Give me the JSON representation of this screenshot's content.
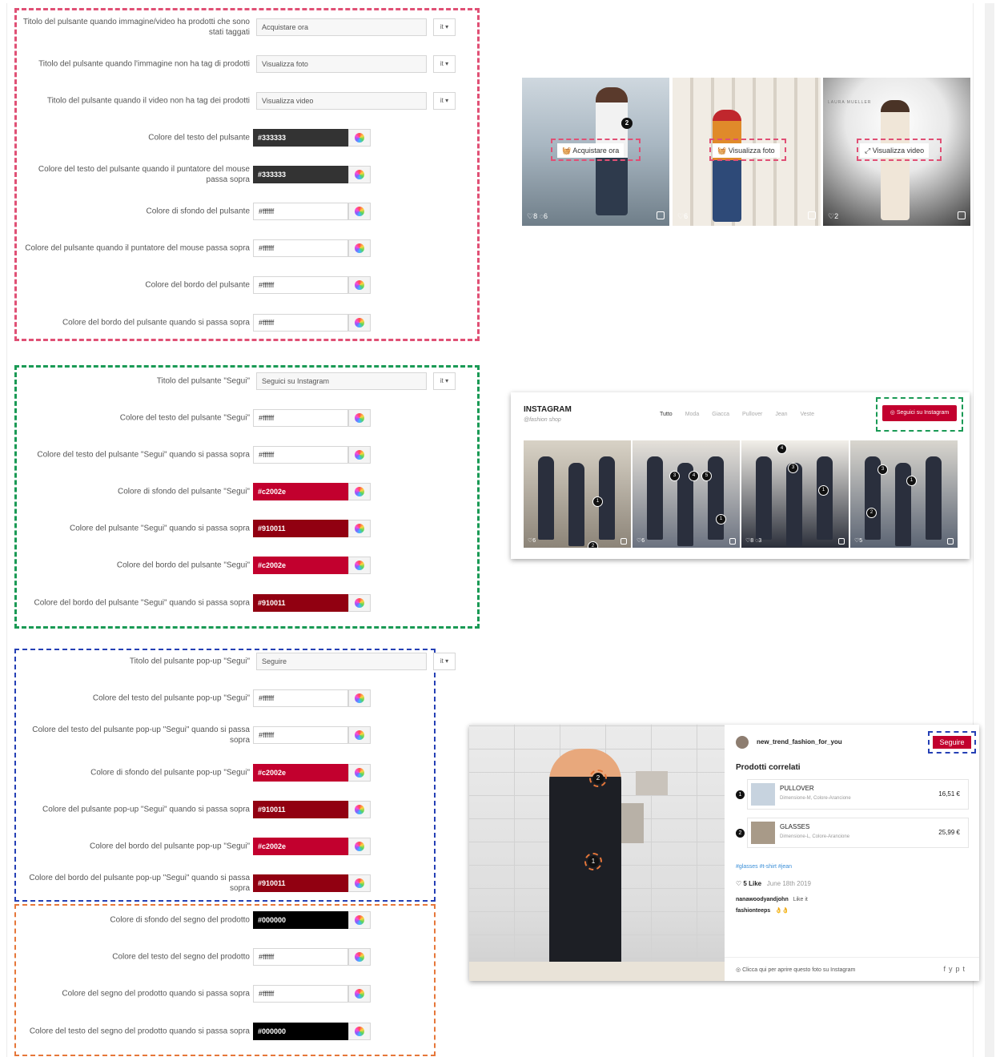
{
  "sections": {
    "shop": {
      "rows": [
        {
          "label": "Titolo del pulsante quando immagine/video ha prodotti che sono stati taggati",
          "type": "text",
          "value": "Acquistare ora",
          "lang": "it ▾"
        },
        {
          "label": "Titolo del pulsante quando l'immagine non ha tag di prodotti",
          "type": "text",
          "value": "Visualizza foto",
          "lang": "it ▾"
        },
        {
          "label": "Titolo del pulsante quando il video non ha tag dei prodotti",
          "type": "text",
          "value": "Visualizza video",
          "lang": "it ▾"
        },
        {
          "label": "Colore del testo del pulsante",
          "type": "color",
          "value": "#333333"
        },
        {
          "label": "Colore del testo del pulsante quando il puntatore del mouse passa sopra",
          "type": "color",
          "value": "#333333"
        },
        {
          "label": "Colore di sfondo del pulsante",
          "type": "color",
          "value": "#ffffff"
        },
        {
          "label": "Colore del pulsante quando il puntatore del mouse passa sopra",
          "type": "color",
          "value": "#ffffff"
        },
        {
          "label": "Colore del bordo del pulsante",
          "type": "color",
          "value": "#ffffff"
        },
        {
          "label": "Colore del bordo del pulsante quando si passa sopra",
          "type": "color",
          "value": "#ffffff"
        }
      ]
    },
    "follow": {
      "rows": [
        {
          "label": "Titolo del pulsante \"Segui\"",
          "type": "text",
          "value": "Seguici su Instagram",
          "lang": "it ▾"
        },
        {
          "label": "Colore del testo del pulsante \"Segui\"",
          "type": "color",
          "value": "#ffffff"
        },
        {
          "label": "Colore del testo del pulsante \"Segui\" quando si passa sopra",
          "type": "color",
          "value": "#ffffff"
        },
        {
          "label": "Colore di sfondo del pulsante \"Segui\"",
          "type": "color",
          "value": "#c2002e"
        },
        {
          "label": "Colore del pulsante \"Segui\" quando si passa sopra",
          "type": "color",
          "value": "#910011"
        },
        {
          "label": "Colore del bordo del pulsante \"Segui\"",
          "type": "color",
          "value": "#c2002e"
        },
        {
          "label": "Colore del bordo del pulsante \"Segui\" quando si passa sopra",
          "type": "color",
          "value": "#910011"
        }
      ]
    },
    "popup": {
      "rows": [
        {
          "label": "Titolo del pulsante pop-up \"Segui\"",
          "type": "text",
          "value": "Seguire",
          "lang": "it ▾"
        },
        {
          "label": "Colore del testo del pulsante pop-up \"Segui\"",
          "type": "color",
          "value": "#ffffff"
        },
        {
          "label": "Colore del testo del pulsante pop-up \"Segui\" quando si passa sopra",
          "type": "color",
          "value": "#ffffff"
        },
        {
          "label": "Colore di sfondo del pulsante pop-up \"Segui\"",
          "type": "color",
          "value": "#c2002e"
        },
        {
          "label": "Colore del pulsante pop-up \"Segui\" quando si passa sopra",
          "type": "color",
          "value": "#910011"
        },
        {
          "label": "Colore del bordo del pulsante pop-up \"Segui\"",
          "type": "color",
          "value": "#c2002e"
        },
        {
          "label": "Colore del bordo del pulsante pop-up \"Segui\" quando si passa sopra",
          "type": "color",
          "value": "#910011"
        }
      ]
    },
    "tag": {
      "rows": [
        {
          "label": "Colore di sfondo del segno del prodotto",
          "type": "color",
          "value": "#000000"
        },
        {
          "label": "Colore del testo del segno del prodotto",
          "type": "color",
          "value": "#ffffff"
        },
        {
          "label": "Colore del segno del prodotto quando si passa sopra",
          "type": "color",
          "value": "#ffffff"
        },
        {
          "label": "Colore del testo del segno del prodotto quando si passa sopra",
          "type": "color",
          "value": "#000000"
        }
      ]
    }
  },
  "preview1": {
    "tiles": [
      {
        "button": "Acquistare ora",
        "icon": "basket-icon",
        "likes": "8",
        "comments": "6",
        "tag": "2"
      },
      {
        "button": "Visualizza foto",
        "icon": "basket-icon",
        "likes": "6"
      },
      {
        "button": "Visualizza video",
        "icon": "expand-icon",
        "likes": "2",
        "caption": "LAURA MUELLER"
      }
    ]
  },
  "preview2": {
    "title": "INSTAGRAM",
    "subtitle": "@fashion shop",
    "tabs": [
      "Tutto",
      "Moda",
      "Giacca",
      "Pullover",
      "Jean",
      "Veste"
    ],
    "follow_button": "Seguici su Instagram",
    "tiles": [
      {
        "likes": "6",
        "tags": [
          "1",
          "2"
        ]
      },
      {
        "likes": "6",
        "tags": [
          "3",
          "4",
          "5",
          "1"
        ]
      },
      {
        "likes": "8",
        "comments": "3",
        "tags": [
          "4",
          "3",
          "1"
        ]
      },
      {
        "likes": "5",
        "tags": [
          "3",
          "1",
          "2"
        ]
      }
    ]
  },
  "preview3": {
    "username": "new_trend_fashion_for_you",
    "follow_button": "Seguire",
    "related_title": "Prodotti correlati",
    "products": [
      {
        "num": "1",
        "name": "PULLOVER",
        "variant": "Dimensione-M, Colore-Arancione",
        "price": "16,51 €"
      },
      {
        "num": "2",
        "name": "GLASSES",
        "variant": "Dimensione-L, Colore-Arancione",
        "price": "25,99 €"
      }
    ],
    "hashtags": "#glasses #t-shirt #jean",
    "likes": "5 Like",
    "date": "June 18th 2019",
    "comments": [
      {
        "user": "nanawoodyandjohn",
        "text": "Like it"
      },
      {
        "user": "fashionteeps",
        "text": "👌👌"
      }
    ],
    "footer": "Clicca qui per aprire questo foto su Instagram",
    "social": [
      "f",
      "y",
      "p",
      "t"
    ],
    "image_tags": [
      "2",
      "1"
    ]
  }
}
